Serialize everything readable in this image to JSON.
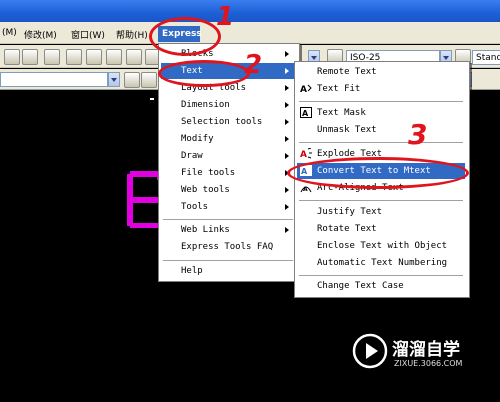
{
  "menubar": {
    "items": [
      "(M)",
      "修改(M)",
      "窗口(W)",
      "帮助(H)"
    ],
    "active": "Express"
  },
  "toolbar": {
    "dimstyle": "ISO-25",
    "style_right": "Stand"
  },
  "express_menu": [
    {
      "label": "Blocks",
      "submenu": true
    },
    {
      "label": "Text",
      "submenu": true,
      "selected": true
    },
    {
      "label": "Layout tools",
      "submenu": true
    },
    {
      "label": "Dimension",
      "submenu": true
    },
    {
      "label": "Selection tools",
      "submenu": true
    },
    {
      "label": "Modify",
      "submenu": true
    },
    {
      "label": "Draw",
      "submenu": true
    },
    {
      "label": "File tools",
      "submenu": true
    },
    {
      "label": "Web tools",
      "submenu": true
    },
    {
      "label": "Tools",
      "submenu": true
    },
    {
      "label": "Web Links",
      "submenu": true
    },
    {
      "label": "Express Tools FAQ"
    },
    {
      "label": "Help"
    }
  ],
  "text_submenu": [
    {
      "label": "Remote Text"
    },
    {
      "label": "Text Fit",
      "icon": "text-fit-icon"
    },
    {
      "label": "Text Mask",
      "icon": "text-mask-icon"
    },
    {
      "label": "Unmask Text"
    },
    {
      "label": "Explode Text",
      "icon": "explode-text-icon"
    },
    {
      "label": "Convert Text to Mtext",
      "icon": "convert-text-icon",
      "selected": true
    },
    {
      "label": "Arc-Aligned Text",
      "icon": "arc-aligned-text-icon"
    },
    {
      "label": "Justify Text"
    },
    {
      "label": "Rotate Text"
    },
    {
      "label": "Enclose Text with Object"
    },
    {
      "label": "Automatic Text Numbering"
    },
    {
      "label": "Change Text Case"
    }
  ],
  "annotations": [
    "1",
    "2",
    "3"
  ],
  "watermark": {
    "title": "溜溜自学",
    "url": "ZIXUE.3066.COM"
  },
  "colors": {
    "selection": "#316ac5",
    "annotation": "#e0141c",
    "drawing_text": "#e000e0"
  }
}
